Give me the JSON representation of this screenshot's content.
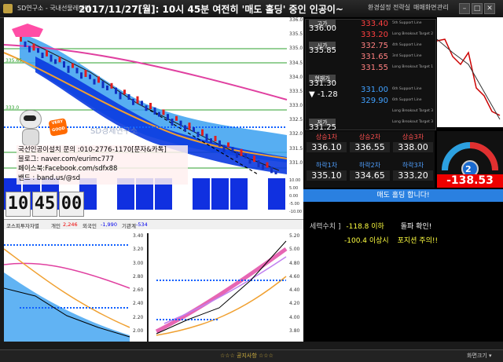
{
  "window": {
    "app_title": "SD연구소 - 국내선물레이더",
    "headline": "2017/11/27[월]: 10시 45분 여전히 '매도 홀딩' 중인 인공이~",
    "toolbar": [
      "환경설정",
      "전략실",
      "매매화면",
      "관리"
    ],
    "footer_left": "☆☆☆ 공지사항 ☆☆☆",
    "footer_right": "화면크기 ▾"
  },
  "info_box": {
    "line1": "국선인공이설치 문의 :010-2776-1170[문자&카톡]",
    "line2": "블로그: naver.com/eurimc777",
    "line3": "페이스북:Facebook.com/sdfx88",
    "line4": "밴드 : band.us/@sd"
  },
  "watermark": "SD경제연구소",
  "badge": "VERY GOOD",
  "clock": {
    "h": "10",
    "m": "45",
    "s": "00"
  },
  "investor_bar": {
    "label": "코스피투자자별",
    "indiv_label": "개인",
    "indiv": "2,246",
    "foreign_label": "외국인",
    "foreign": "-1,990",
    "inst_label": "기관계",
    "inst": "-534"
  },
  "main_chart_ticks": [
    "336.0",
    "335.5",
    "335.0",
    "334.5",
    "334.0",
    "333.5",
    "333.0",
    "332.5",
    "332.0",
    "331.5",
    "331.0"
  ],
  "main_chart_level_labels": [
    "335.65",
    "333.0"
  ],
  "sub_panel_ticks": [
    "10.00",
    "5.00",
    "0.00",
    "-5.00",
    "-10.00"
  ],
  "bl_ticks": [
    "3.40",
    "3.20",
    "3.00",
    "2.80",
    "2.60",
    "2.40",
    "2.20",
    "2.00"
  ],
  "br_ticks": [
    "5.20",
    "5.00",
    "4.80",
    "4.60",
    "4.40",
    "4.20",
    "4.00",
    "3.80"
  ],
  "orderbook": {
    "rows": [
      {
        "label": "고가",
        "value": "336.00",
        "right": "333.40",
        "tag": "5th Support Line",
        "color": "#ff4040"
      },
      {
        "label": "",
        "value": "",
        "right": "333.20",
        "tag": "Long Breakout Target 2",
        "color": "#ff4040"
      },
      {
        "label": "시가",
        "value": "335.85",
        "right": "332.75",
        "tag": "4th Support Line",
        "color": "#ff8080"
      },
      {
        "label": "",
        "value": "",
        "right": "331.65",
        "tag": "3rd Support Line",
        "color": "#ff8080"
      },
      {
        "label": "",
        "value": "",
        "right": "331.55",
        "tag": "Long Breakout Target 1",
        "color": "#ff8080"
      },
      {
        "label": "현재가",
        "value": "331.30",
        "right": "",
        "tag": "",
        "color": "#ffffff"
      },
      {
        "label": "",
        "value": "▼ -1.28",
        "right": "331.00",
        "tag": "6th Support Line",
        "color": "#40a0ff"
      },
      {
        "label": "",
        "value": "",
        "right": "329.90",
        "tag": "6th Support Line",
        "color": "#40a0ff"
      },
      {
        "label": "",
        "value": "",
        "right": "",
        "tag": "Long Breakout Target 3",
        "color": "#40a0ff"
      },
      {
        "label": "저가",
        "value": "331.25",
        "right": "",
        "tag": "Long Breakout Target 3",
        "color": "#40a0ff"
      }
    ]
  },
  "targets": {
    "up_labels": [
      "상승1차",
      "상승2차",
      "상승3차"
    ],
    "up_values": [
      "336.10",
      "336.55",
      "338.00"
    ],
    "down_labels": [
      "하락1차",
      "하락2차",
      "하락3차"
    ],
    "down_values": [
      "335.10",
      "334.65",
      "333.20"
    ]
  },
  "gauge": {
    "value": "-138.53",
    "level": 0.1
  },
  "signal": {
    "title": "매도 홀딩 합니다!",
    "l1a": "세력수치 ]",
    "l1b": "-118.8 이하",
    "l1c": "돌파 확인!",
    "l2a": "-100.4 이상시",
    "l2b": "포지션 주의!!"
  }
}
